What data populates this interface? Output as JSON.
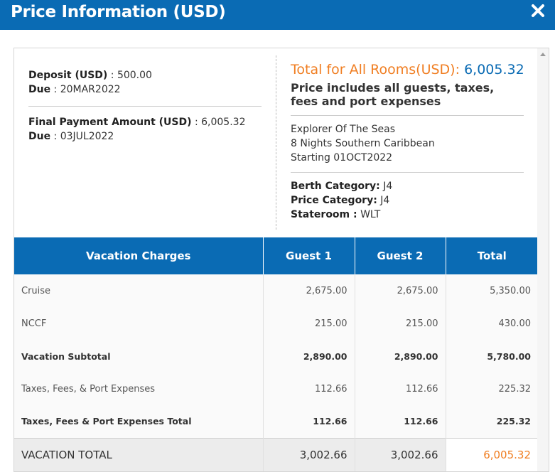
{
  "header": {
    "title": "Price Information (USD)"
  },
  "deposit": {
    "label": "Deposit (USD)",
    "value": " : 500.00",
    "due_label": "Due",
    "due_value": " : 20MAR2022"
  },
  "final": {
    "label": "Final Payment Amount (USD)",
    "value": " : 6,005.32",
    "due_label": "Due",
    "due_value": " : 03JUL2022"
  },
  "total": {
    "label": "Total for All Rooms(USD)",
    "colon": ": ",
    "value": "6,005.32",
    "includes": "Price includes all guests, taxes, fees and port expenses"
  },
  "cruise": {
    "ship": "Explorer Of The Seas",
    "itinerary": "8 Nights Southern Caribbean",
    "starting": "Starting 01OCT2022"
  },
  "categories": {
    "berth_label": "Berth Category:",
    "berth_value": " J4",
    "price_label": "Price Category:",
    "price_value": " J4",
    "stateroom_label": "Stateroom :",
    "stateroom_value": " WLT"
  },
  "table": {
    "headers": [
      "Vacation Charges",
      "Guest 1",
      "Guest 2",
      "Total"
    ],
    "rows": [
      [
        "Cruise",
        "2,675.00",
        "2,675.00",
        "5,350.00"
      ],
      [
        "NCCF",
        "215.00",
        "215.00",
        "430.00"
      ],
      [
        "Vacation Subtotal",
        "2,890.00",
        "2,890.00",
        "5,780.00"
      ],
      [
        "Taxes, Fees, & Port Expenses",
        "112.66",
        "112.66",
        "225.32"
      ],
      [
        "Taxes, Fees & Port Expenses Total",
        "112.66",
        "112.66",
        "225.32"
      ]
    ],
    "vacation_total": [
      "VACATION TOTAL",
      "3,002.66",
      "3,002.66",
      "6,005.32"
    ]
  },
  "colors": {
    "brand_blue": "#0a6bb4",
    "accent_orange": "#f07e22"
  }
}
